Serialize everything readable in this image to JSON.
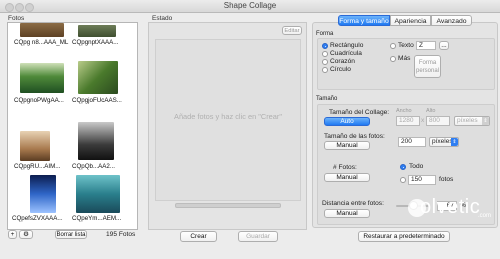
{
  "window": {
    "title": "Shape Collage"
  },
  "photos": {
    "section_label": "Fotos",
    "items": [
      {
        "caption": "CQpg n8...AAA_ML",
        "color": "#7a5a3a"
      },
      {
        "caption": "CQpgnptXAAA...",
        "color": "#5a6a48"
      },
      {
        "caption": "CQpgnoPWgAA...",
        "color": "#2d6b35"
      },
      {
        "caption": "CQpgjoFUcAAS...",
        "color": "#5c7d3b"
      },
      {
        "caption": "CQpgRU...AIM...",
        "color": "#a07a58"
      },
      {
        "caption": "CQpQb...AA2...",
        "color": "#3a3a3a"
      },
      {
        "caption": "CQpefsZVXAAA...",
        "color": "#2a4e9a"
      },
      {
        "caption": "CQpeYm...AEM...",
        "color": "#2c7f8c"
      }
    ],
    "clear_label": "Borrar lista",
    "count_label": "195 Fotos"
  },
  "status": {
    "section_label": "Estado",
    "edit_label": "Editar",
    "drop_hint": "Añade fotos y haz clic en \"Crear\""
  },
  "tabs": [
    {
      "label": "Forma y tamaño",
      "active": true
    },
    {
      "label": "Apariencia",
      "active": false
    },
    {
      "label": "Avanzado",
      "active": false
    }
  ],
  "shape": {
    "section_label": "Forma",
    "options": [
      "Rectángulo",
      "Cuadrícula",
      "Corazón",
      "Círculo"
    ],
    "selected": "Rectángulo",
    "text_label": "Texto",
    "text_value": "Z",
    "more_label": "Más",
    "custom_label": "Forma personal"
  },
  "size": {
    "section_label": "Tamaño",
    "collage_size_label": "Tamaño del Collage:",
    "collage_mode": "Auto",
    "width_label": "Ancho",
    "height_label": "Alto",
    "width_value": "1280",
    "height_value": "800",
    "unit_dimmed": "píxeles",
    "photo_size_label": "Tamaño de las fotos:",
    "photo_mode": "Manual",
    "photo_size_value": "200",
    "photo_unit": "píxeles",
    "count_label": "# Fotos:",
    "count_mode": "Manual",
    "all_label": "Todo",
    "count_value": "150",
    "count_unit": "fotos",
    "spacing_label": "Distancia entre fotos:",
    "spacing_mode": "Manual",
    "spacing_value": "67",
    "spacing_unit": "%"
  },
  "actions": {
    "create_label": "Crear",
    "save_label": "Guardar",
    "reset_label": "Restaurar a predeterminado"
  },
  "watermark": {
    "text": "olvetic",
    "domain": ".com"
  }
}
